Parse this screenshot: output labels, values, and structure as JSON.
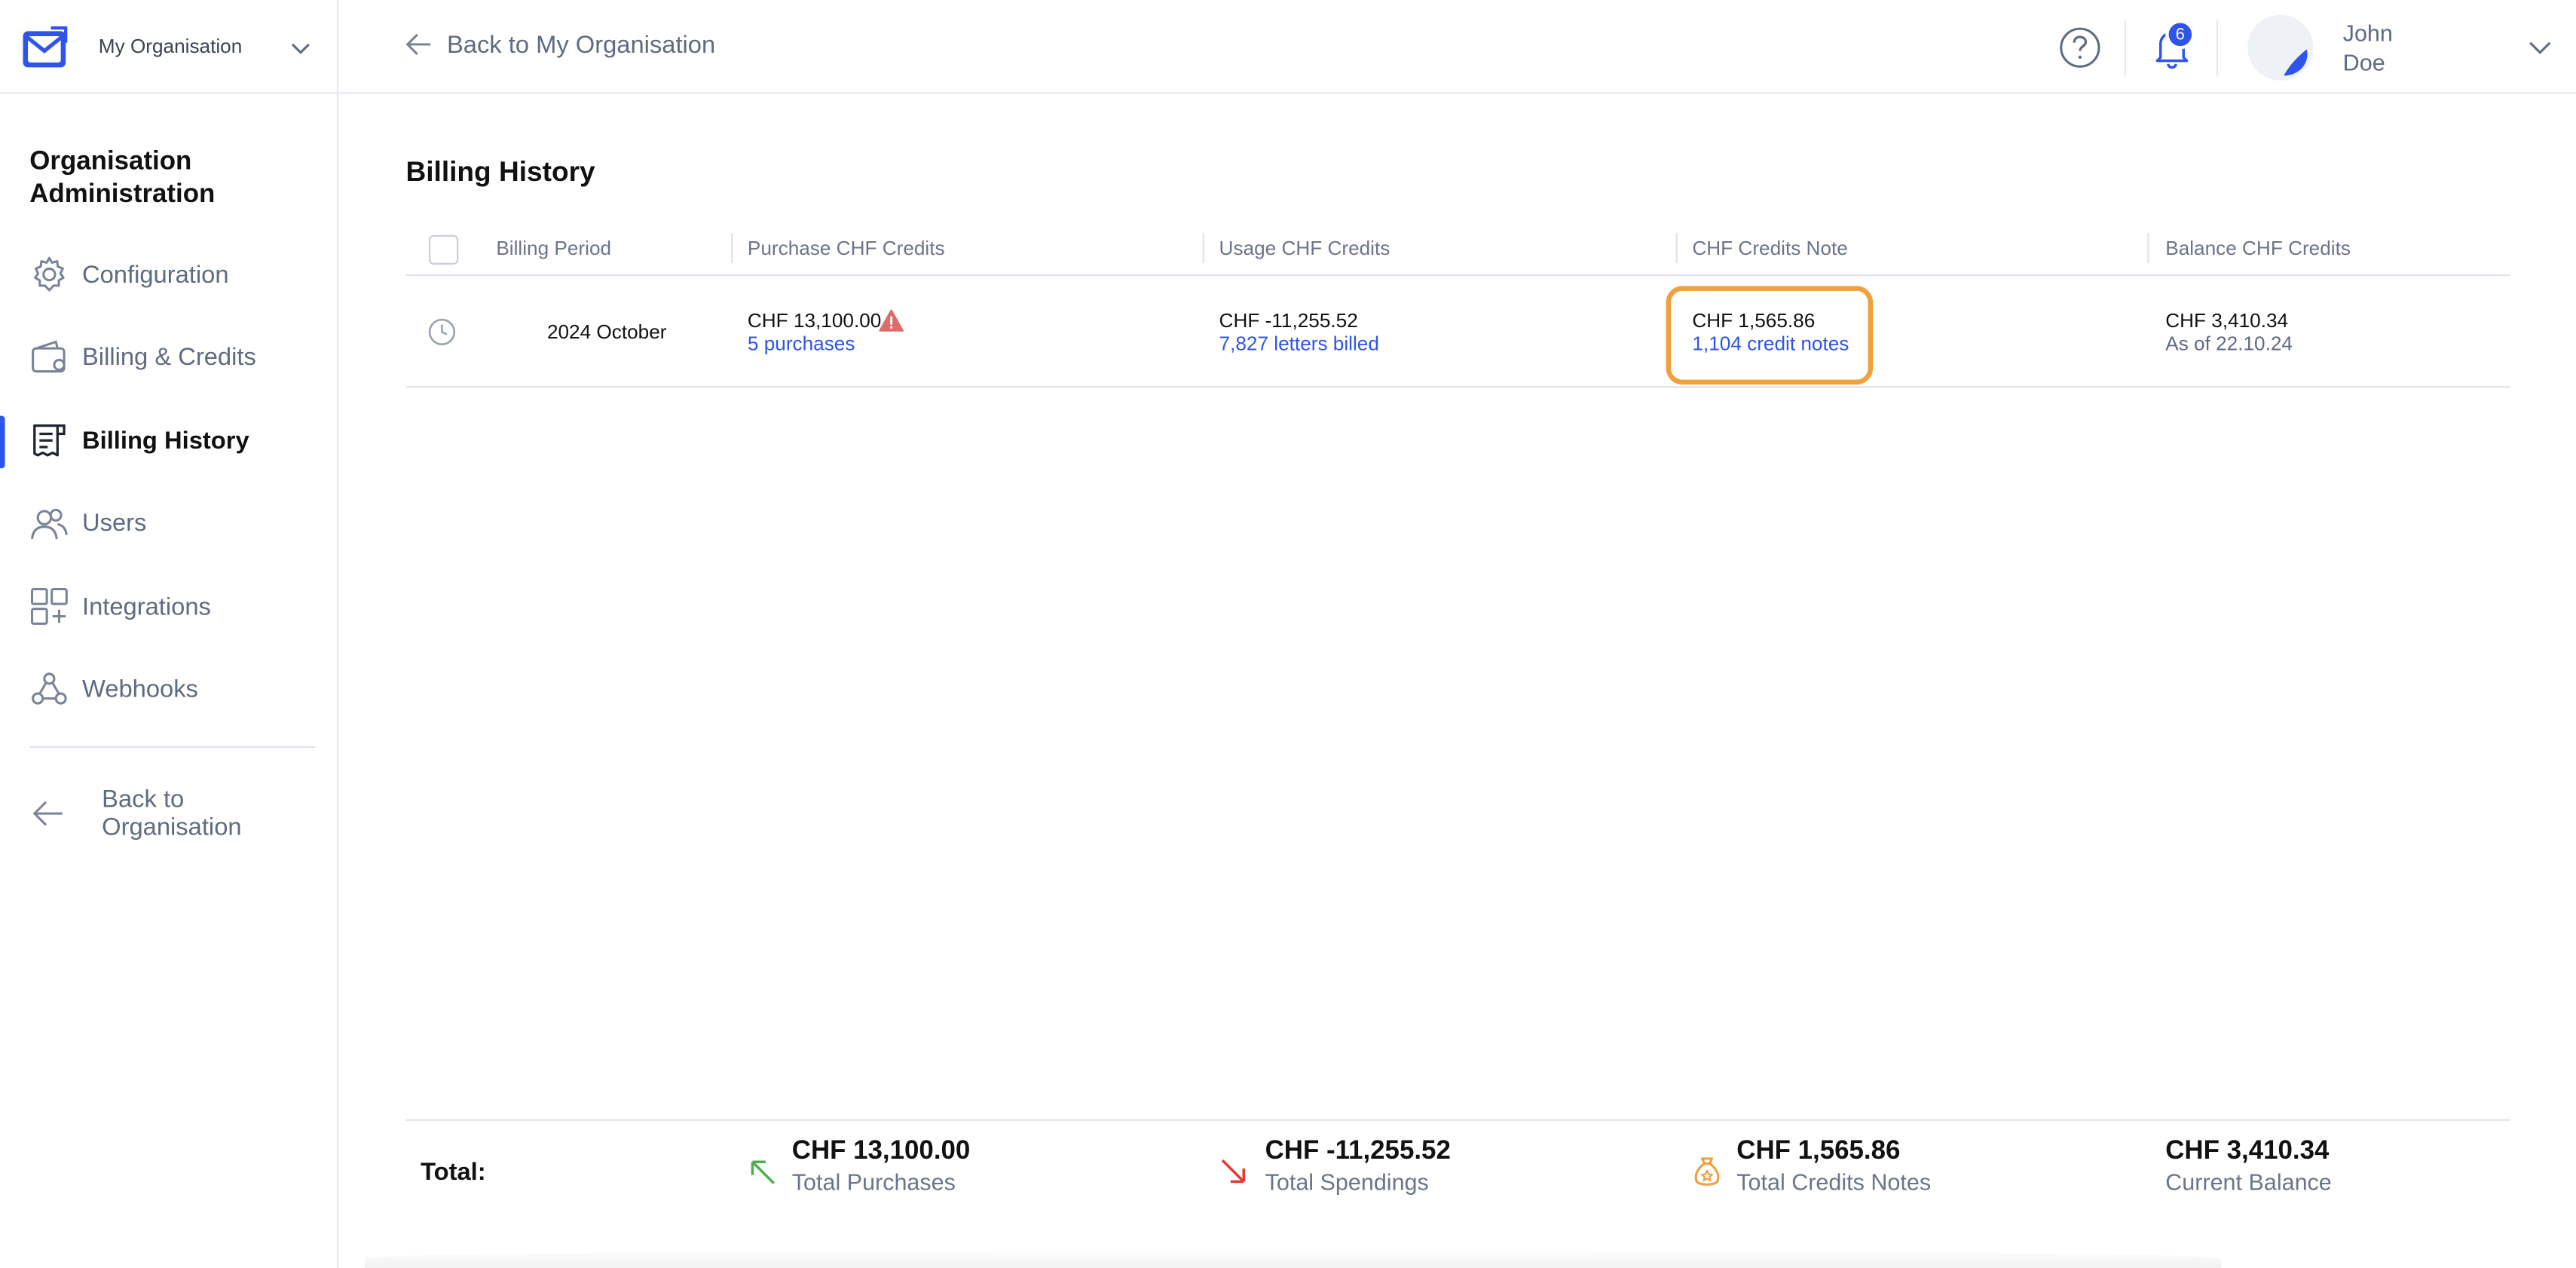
{
  "sidebar": {
    "org_name": "My Organisation",
    "admin_title": "Organisation Administration",
    "items": [
      {
        "label": "Configuration",
        "icon": "gear-icon",
        "active": false
      },
      {
        "label": "Billing & Credits",
        "icon": "wallet-icon",
        "active": false
      },
      {
        "label": "Billing History",
        "icon": "receipt-icon",
        "active": true
      },
      {
        "label": "Users",
        "icon": "users-icon",
        "active": false
      },
      {
        "label": "Integrations",
        "icon": "integrations-icon",
        "active": false
      },
      {
        "label": "Webhooks",
        "icon": "webhooks-icon",
        "active": false
      }
    ],
    "back_label": "Back to Organisation"
  },
  "header": {
    "back_label": "Back to My Organisation",
    "notification_count": "6",
    "user_first": "John",
    "user_last": "Doe"
  },
  "page": {
    "title": "Billing History"
  },
  "table": {
    "columns": [
      "Billing Period",
      "Purchase CHF Credits",
      "Usage CHF Credits",
      "CHF Credits Note",
      "Balance CHF Credits"
    ],
    "rows": [
      {
        "period": "2024 October",
        "purchase": "CHF 13,100.00",
        "purchase_sub": "5 purchases",
        "usage": "CHF -11,255.52",
        "usage_sub": "7,827 letters billed",
        "credits_note": "CHF 1,565.86",
        "credits_note_sub": "1,104 credit notes",
        "balance": "CHF 3,410.34",
        "balance_sub": "As of 22.10.24"
      }
    ]
  },
  "totals": {
    "label": "Total:",
    "purchases_value": "CHF 13,100.00",
    "purchases_label": "Total Purchases",
    "spendings_value": "CHF -11,255.52",
    "spendings_label": "Total Spendings",
    "credits_value": "CHF 1,565.86",
    "credits_label": "Total Credits Notes",
    "balance_value": "CHF 3,410.34",
    "balance_label": "Current Balance"
  },
  "colors": {
    "accent": "#2f54eb",
    "highlight": "#f0a03c",
    "warning": "#e06a6a",
    "positive": "#4caf50",
    "negative": "#e53935"
  }
}
